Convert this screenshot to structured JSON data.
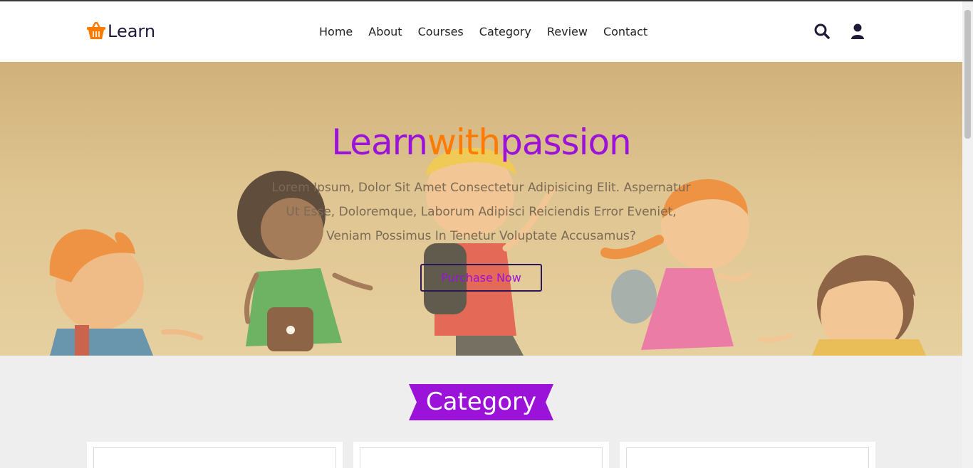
{
  "header": {
    "logo_text": "Learn",
    "nav": [
      "Home",
      "About",
      "Courses",
      "Category",
      "Review",
      "Contact"
    ],
    "icons": [
      "search-icon",
      "user-icon"
    ]
  },
  "hero": {
    "title_part1": "Learn",
    "title_part2": "with",
    "title_part3": "passion",
    "description": "Lorem Ipsum, Dolor Sit Amet Consectetur Adipisicing Elit. Aspernatur Ut Esse, Doloremque, Laborum Adipisci Reiciendis Error Eveniet, Veniam Possimus In Tenetur Voluptate Accusamus?",
    "button": "Purchase Now"
  },
  "category": {
    "title": "Category"
  },
  "colors": {
    "purple": "#9b12d8",
    "orange": "#ff7a00",
    "navy": "#2b1955"
  }
}
